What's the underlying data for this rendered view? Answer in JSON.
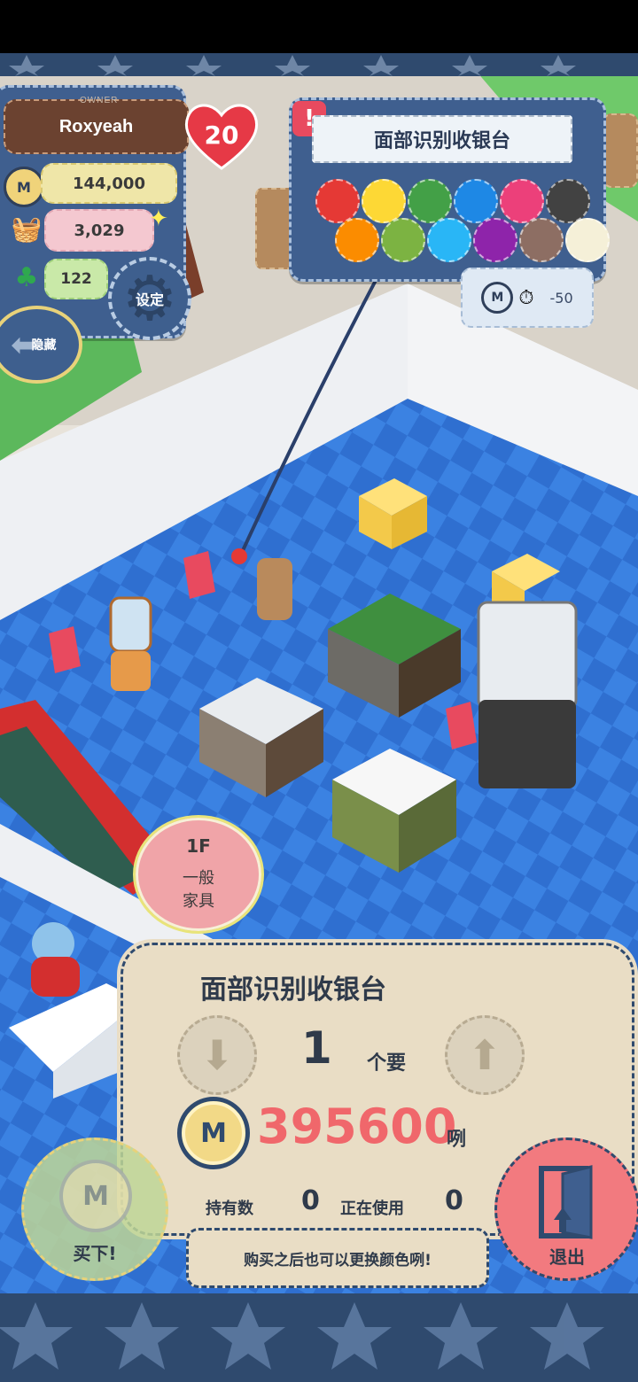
{
  "top": {
    "owner_name": "Roxyeah",
    "owner_tag": "OWNER",
    "level": "20",
    "coins": "144,000",
    "items": "3,029",
    "clovers": "122",
    "settings_label": "设定",
    "hide_label": "隐藏"
  },
  "item_card": {
    "title": "面部识别收银台",
    "time_delta": "-50",
    "colors": [
      "#e53935",
      "#fdd835",
      "#43a047",
      "#1e88e5",
      "#ec407a",
      "#424242",
      "#fb8c00",
      "#7cb342",
      "#29b6f6",
      "#8e24aa",
      "#8d6e63",
      "#f5f0d8"
    ]
  },
  "floor_badge": {
    "floor": "1F",
    "category_line1": "一般",
    "category_line2": "家具"
  },
  "purchase": {
    "title": "面部识别收银台",
    "quantity": "1",
    "quantity_unit": "个要",
    "price": "395600",
    "currency_word": "咧",
    "owned_label": "持有数",
    "owned_value": "0",
    "in_use_label": "正在使用",
    "in_use_value": "0",
    "hint": "购买之后也可以更换颜色咧!"
  },
  "buttons": {
    "buy": "买下!",
    "exit": "退出"
  }
}
